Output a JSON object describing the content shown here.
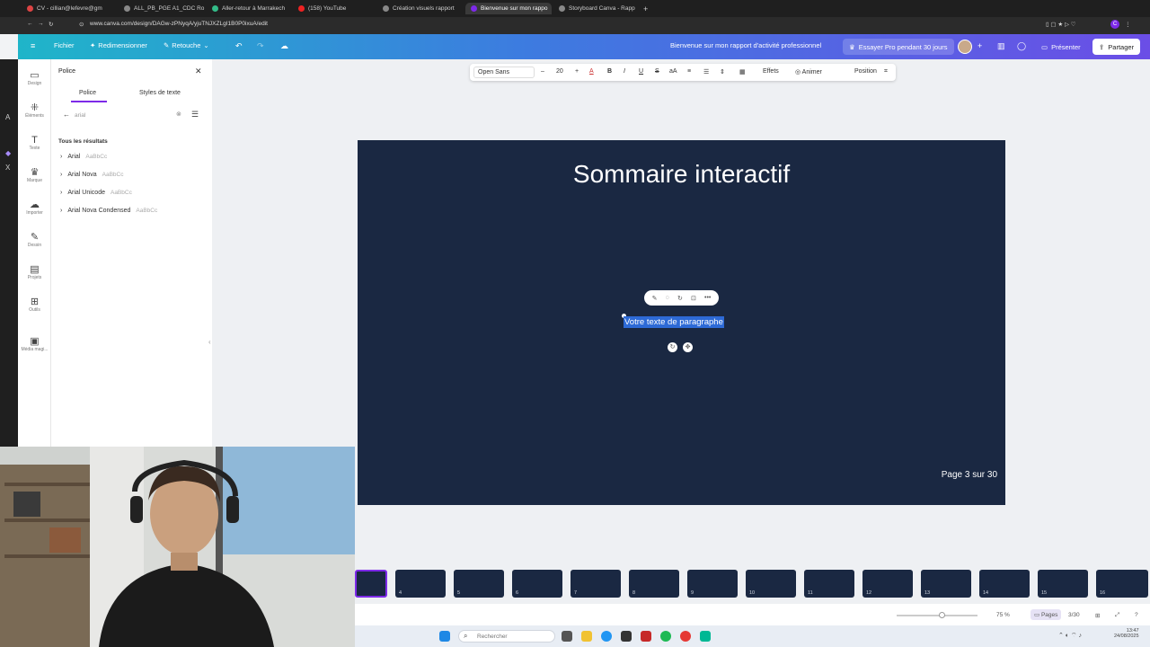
{
  "browser": {
    "tabs": [
      {
        "label": "CV - cillian@lefevre@gm",
        "color": "#d44"
      },
      {
        "label": "ALL_PB_PGE A1_CDC Ro",
        "color": "#888"
      },
      {
        "label": "Aller-retour à Marrakech",
        "color": "#3b8"
      },
      {
        "label": "(158) YouTube",
        "color": "#e22"
      },
      {
        "label": "Création visuels rapport",
        "color": "#888"
      },
      {
        "label": "Bienvenue sur mon rappo",
        "color": "#7d2ae8"
      },
      {
        "label": "Storyboard Canva - Rapp",
        "color": "#888"
      }
    ],
    "url": "www.canva.com/design/DAGw-zPNyqA/yjuTNJXZLgI1B0P0ixuA/edit"
  },
  "topbar": {
    "file": "Fichier",
    "resize": "Redimensionner",
    "edit": "Retouche",
    "doc_title": "Bienvenue sur mon rapport d'activité professionnel",
    "try_pro": "Essayer Pro pendant 30 jours",
    "present": "Présenter",
    "share": "Partager"
  },
  "rail": [
    {
      "label": "Design",
      "icon": "design-icon",
      "glyph": "▭"
    },
    {
      "label": "Éléments",
      "icon": "elements-icon",
      "glyph": "⁜"
    },
    {
      "label": "Texte",
      "icon": "text-icon",
      "glyph": "T"
    },
    {
      "label": "Marque",
      "icon": "brand-icon",
      "glyph": "♛"
    },
    {
      "label": "Importer",
      "icon": "upload-icon",
      "glyph": "☁"
    },
    {
      "label": "Dessin",
      "icon": "draw-icon",
      "glyph": "✎"
    },
    {
      "label": "Projets",
      "icon": "folder-icon",
      "glyph": "▤"
    },
    {
      "label": "Outils",
      "icon": "apps-icon",
      "glyph": "⊞"
    },
    {
      "label": "Média magi...",
      "icon": "magic-media-icon",
      "glyph": "▣"
    }
  ],
  "panel": {
    "title": "Police",
    "tabs": [
      "Police",
      "Styles de texte"
    ],
    "search_value": "arial",
    "results_label": "Tous les résultats",
    "fonts": [
      {
        "name": "Arial",
        "sample": "AaBbCc"
      },
      {
        "name": "Arial Nova",
        "sample": "AaBbCc"
      },
      {
        "name": "Arial Unicode",
        "sample": "AaBbCc"
      },
      {
        "name": "Arial Nova Condensed",
        "sample": "AaBbCc"
      }
    ]
  },
  "text_toolbar": {
    "font": "Open Sans",
    "size": "20",
    "effects": "Effets",
    "animate": "Animer",
    "position": "Position"
  },
  "slide": {
    "title": "Sommaire interactif",
    "paragraph": "Votre texte de paragraphe",
    "page_label": "Page 3 sur 30"
  },
  "thumbnails": [
    "",
    "4",
    "5",
    "6",
    "7",
    "8",
    "9",
    "10",
    "11",
    "12",
    "13",
    "14",
    "15",
    "16"
  ],
  "footer": {
    "zoom": "75 %",
    "pages": "Pages",
    "page_count": "3/30"
  },
  "taskbar": {
    "search_placeholder": "Rechercher",
    "time": "13:47",
    "date": "24/08/2025"
  },
  "colors": {
    "accent": "#7d2ae8",
    "slide_bg": "#1a2842",
    "selection": "#2d6ad6"
  }
}
